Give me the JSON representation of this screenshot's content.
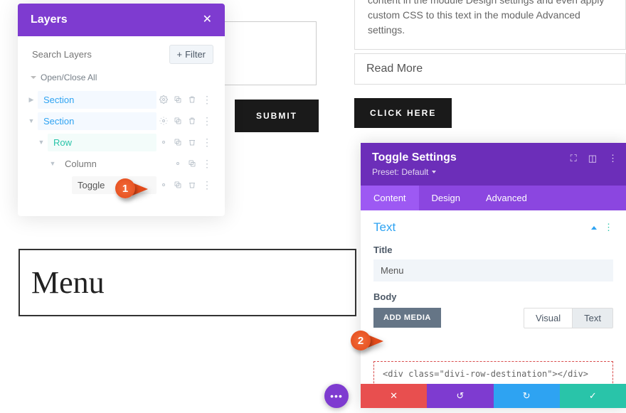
{
  "layers": {
    "title": "Layers",
    "search_placeholder": "Search Layers",
    "filter_label": "Filter",
    "open_close_all": "Open/Close All",
    "items": [
      {
        "label": "Section",
        "type": "section"
      },
      {
        "label": "Section",
        "type": "section"
      },
      {
        "label": "Row",
        "type": "row"
      },
      {
        "label": "Column",
        "type": "column"
      },
      {
        "label": "Toggle",
        "type": "toggle"
      }
    ]
  },
  "page": {
    "submit_label": "SUBMIT",
    "top_text": "content in the module Design settings and even apply custom CSS to this text in the module Advanced settings.",
    "read_more": "Read More",
    "click_here": "CLICK HERE",
    "menu_label": "Menu"
  },
  "settings": {
    "title": "Toggle Settings",
    "preset_label": "Preset: Default",
    "tabs": {
      "content": "Content",
      "design": "Design",
      "advanced": "Advanced"
    },
    "section_title": "Text",
    "title_label": "Title",
    "title_value": "Menu",
    "body_label": "Body",
    "add_media": "ADD MEDIA",
    "editor_tabs": {
      "visual": "Visual",
      "text": "Text"
    },
    "body_code": "<div class=\"divi-row-destination\"></div>"
  },
  "callouts": {
    "one": "1",
    "two": "2"
  }
}
